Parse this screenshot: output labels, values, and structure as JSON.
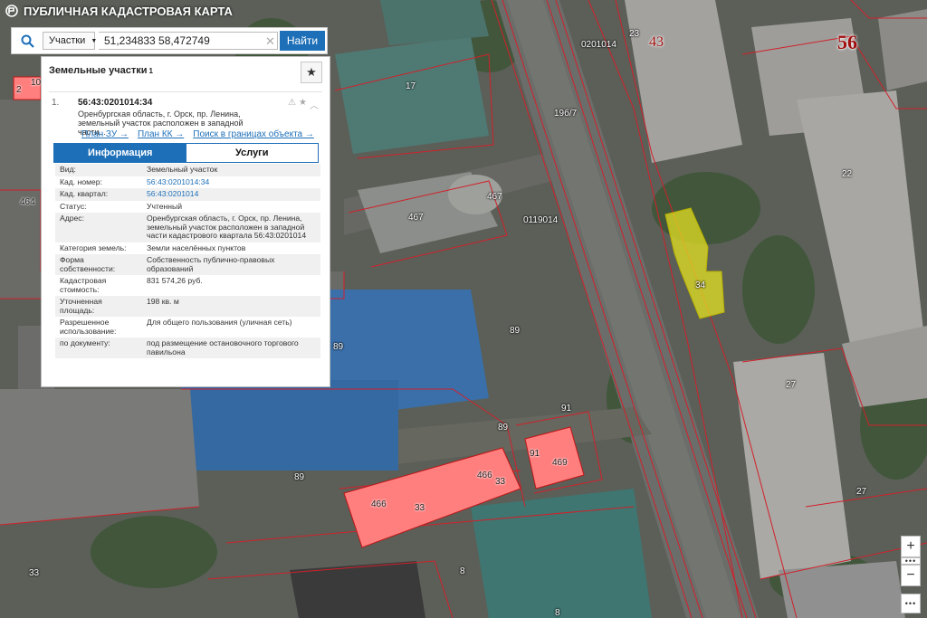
{
  "app": {
    "title": "ПУБЛИЧНАЯ КАДАСТРОВАЯ КАРТА"
  },
  "search": {
    "type_label": "Участки",
    "value": "51,234833 58,472749",
    "button": "Найти"
  },
  "panel": {
    "title": "Земельные участки",
    "count": "1",
    "result": {
      "number": "1.",
      "title": "56:43:0201014:34",
      "description": "Оренбургская область, г. Орск, пр. Ленина, земельный участок расположен в западной части...",
      "links": [
        "План ЗУ →",
        "План КК →",
        "Поиск в границах объекта →"
      ]
    },
    "tabs": [
      "Информация",
      "Услуги"
    ],
    "attributes": [
      {
        "key": "Вид:",
        "value": "Земельный участок"
      },
      {
        "key": "Кад. номер:",
        "value": "56:43:0201014:34"
      },
      {
        "key": "Кад. квартал:",
        "value": "56:43:0201014"
      },
      {
        "key": "Статус:",
        "value": "Учтенный"
      },
      {
        "key": "Адрес:",
        "value": "Оренбургская область, г. Орск, пр. Ленина, земельный участок расположен в западной части кадастрового квартала 56:43:0201014"
      },
      {
        "key": "Категория земель:",
        "value": "Земли населённых пунктов"
      },
      {
        "key": "Форма собственности:",
        "value": "Собственность публично-правовых образований"
      },
      {
        "key": "Кадастровая стоимость:",
        "value": "831 574,26 руб."
      },
      {
        "key": "Уточненная площадь:",
        "value": "198 кв. м"
      },
      {
        "key": "Разрешенное использование:",
        "value": "Для общего пользования (уличная сеть)"
      },
      {
        "key": "по документу:",
        "value": "под размещение остановочного торгового павильона"
      }
    ]
  },
  "map": {
    "labels": [
      "0201014",
      "19б/7",
      "0119014",
      "17",
      "467",
      "467",
      "89",
      "89",
      "89",
      "89",
      "91",
      "91",
      "469",
      "466",
      "466",
      "33",
      "33",
      "34",
      "22",
      "27",
      "27",
      "8",
      "8",
      "33",
      "23",
      "43",
      "56",
      "464",
      "2",
      "10"
    ],
    "highlight_color": "#e3e022",
    "selected_color": "#ff7f7f",
    "boundary_color": "#d2202a"
  },
  "zoom": {
    "in": "+",
    "out": "−"
  }
}
